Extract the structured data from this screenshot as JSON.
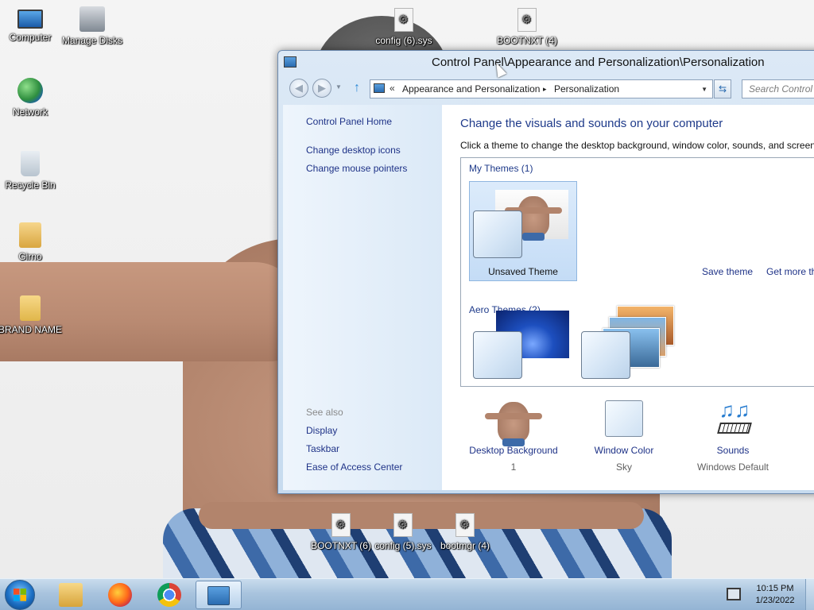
{
  "desktop": {
    "icons": [
      {
        "label": "Computer"
      },
      {
        "label": "Manage Disks"
      },
      {
        "label": "Network"
      },
      {
        "label": "Recycle Bin"
      },
      {
        "label": "Girno"
      },
      {
        "label": "BRAND NAME"
      },
      {
        "label": "config (6).sys"
      },
      {
        "label": "BOOTNXT (4)"
      },
      {
        "label": "BOOTNXT (6)"
      },
      {
        "label": "config (5).sys"
      },
      {
        "label": "bootmgr (4)"
      }
    ]
  },
  "window": {
    "title": "Control Panel\\Appearance and Personalization\\Personalization",
    "address": {
      "overflow": "«",
      "crumbs": [
        "Appearance and Personalization",
        "Personalization"
      ],
      "separator": "▸"
    },
    "search_placeholder": "Search Control Panel",
    "left_pane": {
      "home": "Control Panel Home",
      "links": [
        "Change desktop icons",
        "Change mouse pointers"
      ],
      "see_also_label": "See also",
      "see_also": [
        "Display",
        "Taskbar",
        "Ease of Access Center"
      ]
    },
    "main": {
      "heading": "Change the visuals and sounds on your computer",
      "description": "Click a theme to change the desktop background, window color, sounds, and screen saver all at once.",
      "groups": {
        "my_themes": "My Themes (1)",
        "aero_themes": "Aero Themes (2)"
      },
      "unsaved_theme_label": "Unsaved Theme",
      "save_theme": "Save theme",
      "get_more": "Get more themes online",
      "bottom": [
        {
          "label": "Desktop Background",
          "value": "1"
        },
        {
          "label": "Window Color",
          "value": "Sky"
        },
        {
          "label": "Sounds",
          "value": "Windows Default"
        }
      ]
    }
  },
  "taskbar": {
    "time": "10:15 PM",
    "date": "1/23/2022"
  },
  "colors": {
    "link": "#1e3287",
    "heading": "#1e3a8a",
    "taskbar": "#a9c4de"
  }
}
